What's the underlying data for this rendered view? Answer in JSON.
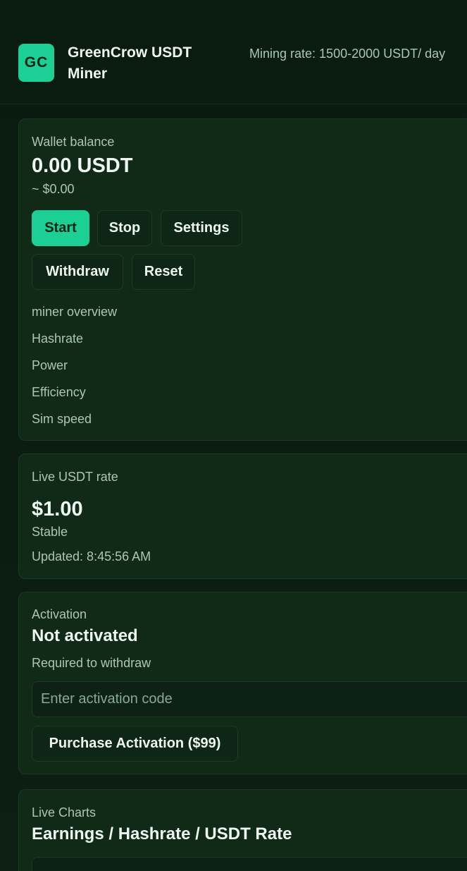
{
  "header": {
    "logo_text": "GC",
    "title": "GreenCrow USDT Miner",
    "mining_rate": "Mining rate: 1500-2000 USDT/ day"
  },
  "wallet": {
    "label": "Wallet balance",
    "balance": "0.00 USDT",
    "usd_value": "~ $0.00",
    "buttons": {
      "start": "Start",
      "stop": "Stop",
      "settings": "Settings",
      "withdraw": "Withdraw",
      "reset": "Reset"
    },
    "overview_title": "miner overview",
    "stats": {
      "hashrate": "Hashrate",
      "power": "Power",
      "efficiency": "Efficiency",
      "sim_speed": "Sim speed"
    }
  },
  "rate": {
    "label": "Live USDT rate",
    "value": "$1.00",
    "status": "Stable",
    "updated": "Updated: 8:45:56 AM"
  },
  "activation": {
    "label": "Activation",
    "status": "Not activated",
    "note": "Required to withdraw",
    "code_placeholder": "Enter activation code",
    "code_value": "",
    "purchase_button": "Purchase Activation ($99)"
  },
  "charts": {
    "label": "Live Charts",
    "title": "Earnings / Hashrate / USDT Rate"
  },
  "colors": {
    "accent": "#1ccf95",
    "background": "#0b1a10",
    "card": "#102a17",
    "muted_text": "#a7c8b3"
  }
}
